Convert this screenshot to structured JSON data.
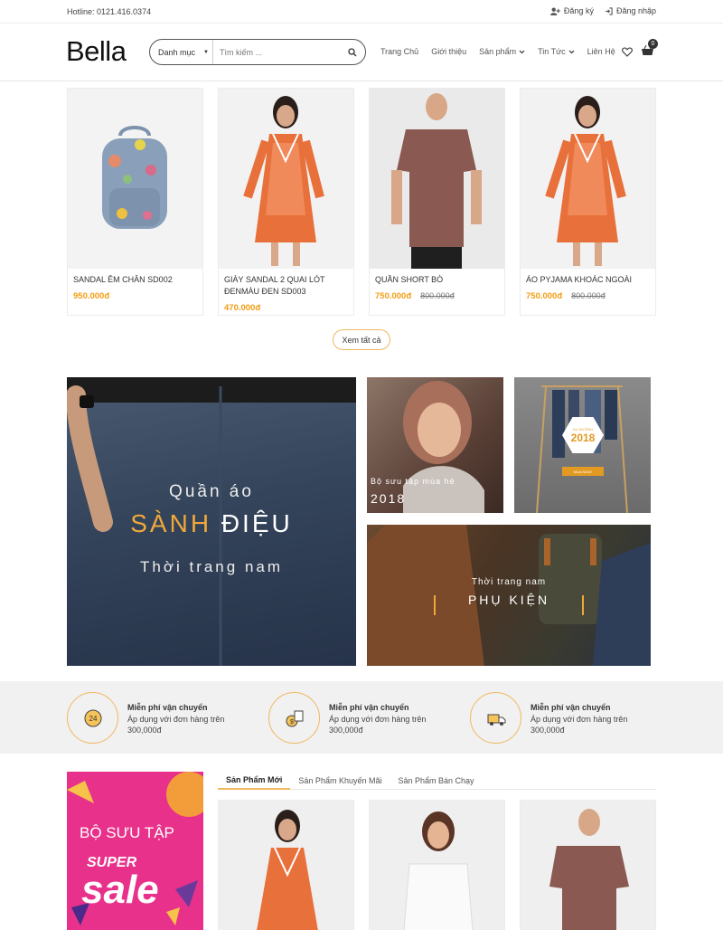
{
  "topbar": {
    "hotline": "Hotline: 0121.416.0374",
    "register": "Đăng ký",
    "login": "Đăng nhập"
  },
  "header": {
    "logo": "Bella",
    "search_category": "Danh mục",
    "search_placeholder": "Tìm kiếm ...",
    "nav": [
      "Trang Chủ",
      "Giới thiệu",
      "Sản phẩm",
      "Tin Tức",
      "Liên Hệ"
    ],
    "cart_count": "0"
  },
  "products": [
    {
      "name": "SANDAL ÊM CHÂN SD002",
      "price": "950.000đ",
      "old_price": ""
    },
    {
      "name": "GIÀY SANDAL 2 QUAI LÓT ĐENMÀU ĐEN SD003",
      "price": "470.000đ",
      "old_price": ""
    },
    {
      "name": "QUẦN SHORT BÒ",
      "price": "750.000đ",
      "old_price": "800.000đ"
    },
    {
      "name": "ÁO PYJAMA KHOÁC NGOÀI",
      "price": "750.000đ",
      "old_price": "800.000đ"
    }
  ],
  "more_button": "Xem tất cả",
  "banners": {
    "main_line1": "Quần áo",
    "main_line2a": "SÀNH",
    "main_line2b": " ĐIỆU",
    "main_line3": "Thời trang nam",
    "summer_line1": "Bộ sưu tập mùa hè",
    "summer_line2": "2018",
    "trend_small": "XU HƯỚNG",
    "trend_year": "2018",
    "trend_button": "MUA NGAY",
    "acc_line1": "Thời trang nam",
    "acc_line2": "PHỤ KIỆN"
  },
  "features": [
    {
      "title": "Miễn phí vận chuyển",
      "desc": "Áp dụng với đơn hàng trên 300,000đ",
      "icon": "24h-clock-icon"
    },
    {
      "title": "Miễn phí vận chuyển",
      "desc": "Áp dụng với đơn hàng trên 300,000đ",
      "icon": "money-icon"
    },
    {
      "title": "Miễn phí vận chuyển",
      "desc": "Áp dụng với đơn hàng trên 300,000đ",
      "icon": "delivery-truck-icon"
    }
  ],
  "sale_banner": {
    "line1": "BỘ SƯU TẬP",
    "line2": "SUPER",
    "line3": "sale"
  },
  "tabs": [
    "Sản Phẩm Mới",
    "Sản Phẩm Khuyến Mãi",
    "Sản Phẩm Bán Chạy"
  ],
  "colors": {
    "accent": "#f39c12",
    "sale_pink": "#e8318a"
  }
}
